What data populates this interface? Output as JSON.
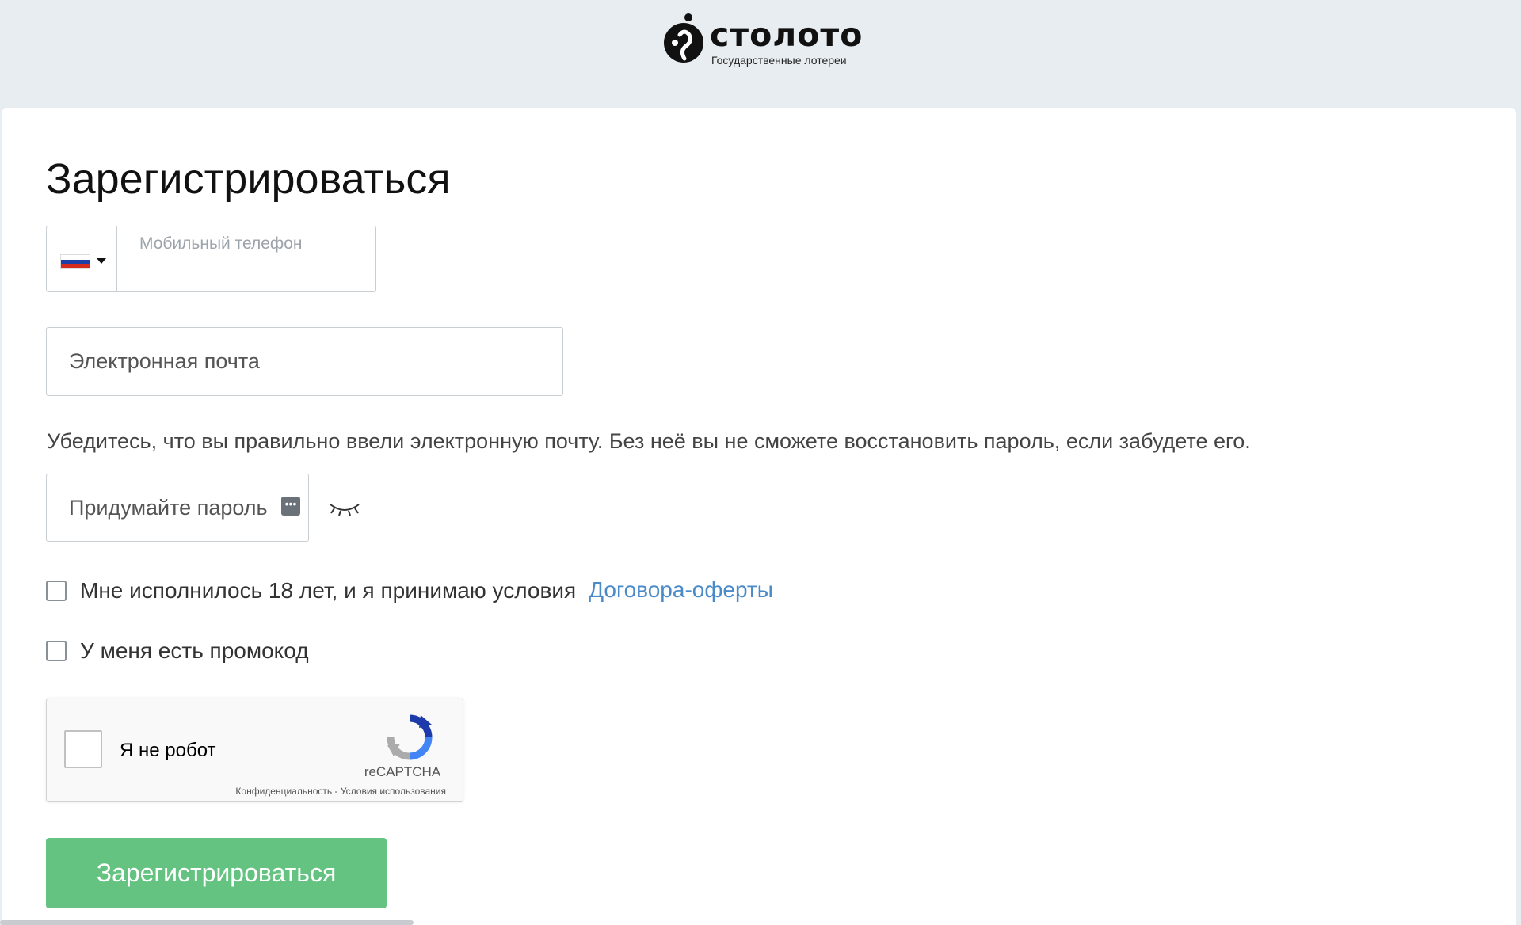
{
  "header": {
    "logo_text": "столото",
    "logo_subtitle": "Государственные лотереи"
  },
  "form": {
    "title": "Зарегистрироваться",
    "phone": {
      "country": "Russia",
      "placeholder": "Мобильный телефон",
      "value": ""
    },
    "email": {
      "placeholder": "Электронная почта",
      "value": ""
    },
    "email_hint": "Убедитесь, что вы правильно ввели электронную почту. Без неё вы не сможете восстановить пароль, если забудете его.",
    "password": {
      "placeholder": "Придумайте пароль",
      "value": ""
    },
    "age_checkbox": {
      "label": "Мне исполнилось 18 лет, и я принимаю условия",
      "link_text": "Договора-оферты",
      "checked": false
    },
    "promo_checkbox": {
      "label": "У меня есть промокод",
      "checked": false
    },
    "recaptcha": {
      "label": "Я не робот",
      "brand": "reCAPTCHA",
      "links": "Конфиденциальность - Условия использования"
    },
    "submit_label": "Зарегистрироваться"
  },
  "colors": {
    "page_background": "#e8edf1",
    "submit_button": "#65c382",
    "link": "#4a8ac9"
  }
}
